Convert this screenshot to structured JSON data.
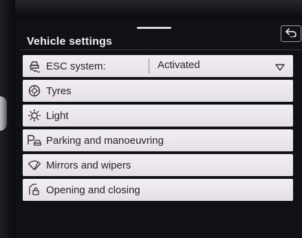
{
  "header": {
    "title": "Vehicle settings",
    "back_icon": "back-arrow-icon"
  },
  "menu": {
    "esc": {
      "label": "ESC system:",
      "value": "Activated",
      "icon": "esc-skid-icon"
    },
    "items": [
      {
        "label": "Tyres",
        "icon": "tyre-icon"
      },
      {
        "label": "Light",
        "icon": "light-icon"
      },
      {
        "label": "Parking and manoeuvring",
        "icon": "parking-icon"
      },
      {
        "label": "Mirrors and wipers",
        "icon": "wiper-icon"
      },
      {
        "label": "Opening and closing",
        "icon": "door-lock-icon"
      }
    ]
  },
  "colors": {
    "accent": "#f2f2f2",
    "row_background": "#ece8ee",
    "screen_background": "#101114"
  }
}
